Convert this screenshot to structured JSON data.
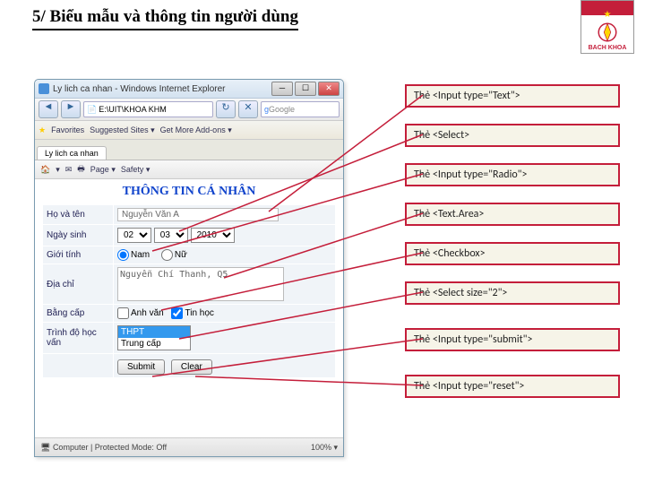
{
  "header": "5/ Biểu mẫu và thông tin người dùng",
  "logo": {
    "star": "★",
    "text": "BACH KHOA"
  },
  "browser": {
    "title": "Ly lich ca nhan - Windows Internet Explorer",
    "addr": "E:\\UIT\\KHOA KHM",
    "search": "Google",
    "favorites": "Favorites",
    "suggested": "Suggested Sites ▾",
    "getmore": "Get More Add-ons ▾",
    "tab": "Ly lich ca nhan",
    "tb_page": "Page ▾",
    "tb_safety": "Safety ▾",
    "status_l": "Computer | Protected Mode: Off",
    "status_r": "100%  ▾"
  },
  "form": {
    "title": "THÔNG TIN CÁ NHÂN",
    "rows": {
      "name_lbl": "Họ và tên",
      "name_val": "Nguyễn Văn A",
      "dob_lbl": "Ngày sinh",
      "dob_d": "02",
      "dob_m": "03",
      "dob_y": "2010",
      "sex_lbl": "Giới tính",
      "sex_m": "Nam",
      "sex_f": "Nữ",
      "addr_lbl": "Địa chỉ",
      "addr_val": "Nguyễn Chí Thanh, Q5",
      "cert_lbl": "Bằng cấp",
      "cert_en": "Anh văn",
      "cert_it": "Tin học",
      "edu_lbl": "Trình độ học vấn",
      "edu_op1": "THPT",
      "edu_op2": "Trung cấp",
      "btn_submit": "Submit",
      "btn_clear": "Clear"
    }
  },
  "callouts": [
    "Thẻ <Input type=\"Text\">",
    "Thẻ <Select>",
    "Thẻ <Input type=\"Radio\">",
    "Thẻ <Text.Area>",
    "Thẻ <Checkbox>",
    "Thẻ <Select size=\"2\">",
    "Thẻ <Input type=\"submit\">",
    "Thẻ <Input type=\"reset\">"
  ]
}
